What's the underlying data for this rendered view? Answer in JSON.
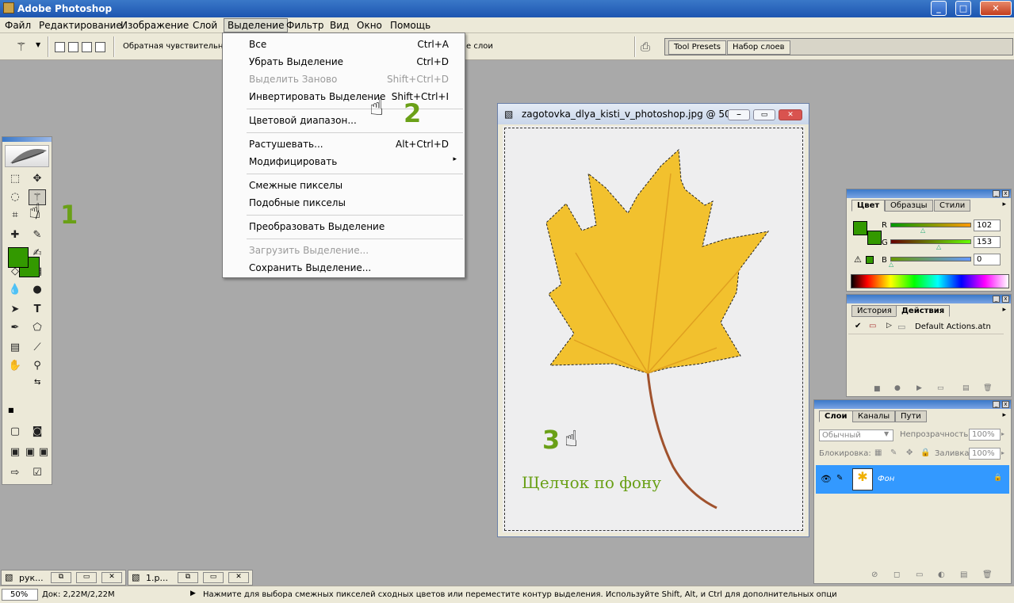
{
  "app": {
    "title": "Adobe Photoshop"
  },
  "menubar": {
    "items": [
      "Файл",
      "Редактирование",
      "Изображение",
      "Слой",
      "Выделение",
      "Фильтр",
      "Вид",
      "Окно",
      "Помощь"
    ]
  },
  "options_bar": {
    "label": "Обратная чувствительно",
    "trail": "е слои",
    "tabs": [
      "Tool Presets",
      "Набор слоев"
    ]
  },
  "select_menu": {
    "items": [
      {
        "label": "Все",
        "shortcut": "Ctrl+A",
        "disabled": false
      },
      {
        "label": "Убрать Выделение",
        "shortcut": "Ctrl+D",
        "disabled": false
      },
      {
        "label": "Выделить Заново",
        "shortcut": "Shift+Ctrl+D",
        "disabled": true
      },
      {
        "label": "Инвертировать Выделение",
        "shortcut": "Shift+Ctrl+I",
        "disabled": false
      },
      {
        "label": "Цветовой диапазон...",
        "shortcut": "",
        "disabled": false
      },
      {
        "label": "Растушевать...",
        "shortcut": "Alt+Ctrl+D",
        "disabled": false
      },
      {
        "label": "Модифицировать",
        "shortcut": "",
        "disabled": false,
        "submenu": true
      },
      {
        "label": "Смежные пикселы",
        "shortcut": "",
        "disabled": false
      },
      {
        "label": "Подобные пикселы",
        "shortcut": "",
        "disabled": false
      },
      {
        "label": "Преобразовать Выделение",
        "shortcut": "",
        "disabled": false
      },
      {
        "label": "Загрузить Выделение...",
        "shortcut": "",
        "disabled": true
      },
      {
        "label": "Сохранить Выделение...",
        "shortcut": "",
        "disabled": false
      }
    ],
    "submenu_arrow": "▸"
  },
  "callouts": {
    "one": "1",
    "two": "2",
    "three": "3"
  },
  "document": {
    "title": "zagotovka_dlya_kisti_v_photoshop.jpg @ 50...",
    "caption": "Щелчок по фону"
  },
  "color_panel": {
    "tabs": [
      "Цвет",
      "Образцы",
      "Стили"
    ],
    "channels": [
      {
        "name": "R",
        "value": "102"
      },
      {
        "name": "G",
        "value": "153"
      },
      {
        "name": "B",
        "value": "0"
      }
    ],
    "foreground": "#339900"
  },
  "actions_panel": {
    "tabs": [
      "История",
      "Действия"
    ],
    "item": "Default Actions.atn"
  },
  "layers_panel": {
    "tabs": [
      "Слои",
      "Каналы",
      "Пути"
    ],
    "blend_mode": "Обычный",
    "opacity_label": "Непрозрачность:",
    "opacity": "100%",
    "lock_label": "Блокировка:",
    "fill_label": "Заливка:",
    "fill": "100%",
    "layer_name": "Фон"
  },
  "minimized": [
    {
      "label": "рук..."
    },
    {
      "label": "1.р..."
    }
  ],
  "status": {
    "zoom": "50%",
    "doc": "Док: 2,22M/2,22M",
    "hint": "Нажмите для выбора смежных пикселей сходных цветов или переместите контур выделения. Используйте Shift, Alt, и Ctrl для дополнительных опци"
  }
}
